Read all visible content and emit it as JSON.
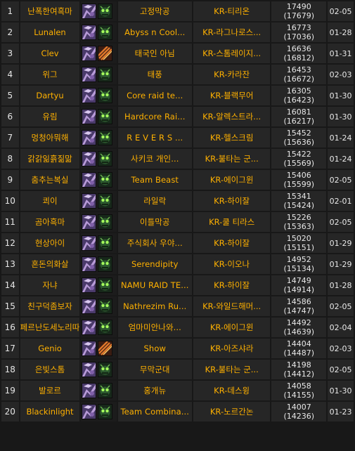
{
  "rows": [
    {
      "rank": "1",
      "name": "난폭한여흑마",
      "class_icon": "warlock-class-icon",
      "spec_icon": "warlock-spec-icon",
      "guild": "고정막공",
      "realm": "KR-티리온",
      "score": "17490",
      "score_alt": "(17679)",
      "date": "02-05"
    },
    {
      "rank": "2",
      "name": "Lunalen",
      "class_icon": "warlock-class-icon",
      "spec_icon": "warlock-spec-icon",
      "guild": "Abyss n Cool...",
      "realm": "KR-라그나로스...",
      "score": "16773",
      "score_alt": "(17036)",
      "date": "01-28"
    },
    {
      "rank": "3",
      "name": "Clev",
      "class_icon": "warlock-class-icon",
      "spec_icon": "destruction-spec-icon",
      "guild": "태국인 아님",
      "realm": "KR-스톰레이지...",
      "score": "16636",
      "score_alt": "(16812)",
      "date": "01-31"
    },
    {
      "rank": "4",
      "name": "위그",
      "class_icon": "warlock-class-icon",
      "spec_icon": "warlock-spec-icon",
      "guild": "태풍",
      "realm": "KR-카라잔",
      "score": "16453",
      "score_alt": "(16672)",
      "date": "02-03"
    },
    {
      "rank": "5",
      "name": "Dartyu",
      "class_icon": "warlock-class-icon",
      "spec_icon": "warlock-spec-icon",
      "guild": "Core raid te...",
      "realm": "KR-블랙무어",
      "score": "16305",
      "score_alt": "(16423)",
      "date": "01-30"
    },
    {
      "rank": "6",
      "name": "유림",
      "class_icon": "warlock-class-icon",
      "spec_icon": "warlock-spec-icon",
      "guild": "Hardcore Rai...",
      "realm": "KR-알렉스트라...",
      "score": "16081",
      "score_alt": "(16217)",
      "date": "01-30"
    },
    {
      "rank": "7",
      "name": "멍청아뭐해",
      "class_icon": "warlock-class-icon",
      "spec_icon": "warlock-spec-icon",
      "guild": "R E V E R S ...",
      "realm": "KR-헬스크림",
      "score": "15452",
      "score_alt": "(15636)",
      "date": "01-24"
    },
    {
      "rank": "8",
      "name": "갉갉읾흙짊맒",
      "class_icon": "warlock-class-icon",
      "spec_icon": "warlock-spec-icon",
      "guild": "사키코 개인...",
      "realm": "KR-불타는 군...",
      "score": "15422",
      "score_alt": "(15569)",
      "date": "01-24"
    },
    {
      "rank": "9",
      "name": "춤추는복실",
      "class_icon": "warlock-class-icon",
      "spec_icon": "warlock-spec-icon",
      "guild": "Team Beast",
      "realm": "KR-에이그윈",
      "score": "15406",
      "score_alt": "(15599)",
      "date": "02-05"
    },
    {
      "rank": "10",
      "name": "쾨이",
      "class_icon": "warlock-class-icon",
      "spec_icon": "warlock-spec-icon",
      "guild": "라일락",
      "realm": "KR-하이잘",
      "score": "15341",
      "score_alt": "(15424)",
      "date": "02-01"
    },
    {
      "rank": "11",
      "name": "곰아흑마",
      "class_icon": "warlock-class-icon",
      "spec_icon": "warlock-spec-icon",
      "guild": "이틀막공",
      "realm": "KR-쿨 티라스",
      "score": "15226",
      "score_alt": "(15363)",
      "date": "02-05"
    },
    {
      "rank": "12",
      "name": "현상아이",
      "class_icon": "warlock-class-icon",
      "spec_icon": "warlock-spec-icon",
      "guild": "주식회사 우야...",
      "realm": "KR-하이잘",
      "score": "15020",
      "score_alt": "(15151)",
      "date": "01-29"
    },
    {
      "rank": "13",
      "name": "혼돈의화살",
      "class_icon": "warlock-class-icon",
      "spec_icon": "warlock-spec-icon",
      "guild": "Serendipity",
      "realm": "KR-이오나",
      "score": "14952",
      "score_alt": "(15134)",
      "date": "01-29"
    },
    {
      "rank": "14",
      "name": "자냐",
      "class_icon": "warlock-class-icon",
      "spec_icon": "warlock-spec-icon",
      "guild": "NAMU RAID TE...",
      "realm": "KR-하이잘",
      "score": "14749",
      "score_alt": "(14914)",
      "date": "01-28"
    },
    {
      "rank": "15",
      "name": "친구덕좀보자",
      "class_icon": "warlock-class-icon",
      "spec_icon": "warlock-spec-icon",
      "guild": "Nathrezim Ru...",
      "realm": "KR-와일드해머...",
      "score": "14586",
      "score_alt": "(14747)",
      "date": "02-05"
    },
    {
      "rank": "16",
      "name": "페르난도세노리따",
      "class_icon": "warlock-class-icon",
      "spec_icon": "warlock-spec-icon",
      "guild": "엄마미안나와...",
      "realm": "KR-에이그윈",
      "score": "14492",
      "score_alt": "(14639)",
      "date": "02-04"
    },
    {
      "rank": "17",
      "name": "Genio",
      "class_icon": "warlock-class-icon",
      "spec_icon": "destruction-spec-icon",
      "guild": "Show",
      "realm": "KR-아즈샤라",
      "score": "14404",
      "score_alt": "(14487)",
      "date": "02-03"
    },
    {
      "rank": "18",
      "name": "은빛스톰",
      "class_icon": "warlock-class-icon",
      "spec_icon": "warlock-spec-icon",
      "guild": "무막군대",
      "realm": "KR-불타는 군...",
      "score": "14198",
      "score_alt": "(14412)",
      "date": "02-05"
    },
    {
      "rank": "19",
      "name": "발로르",
      "class_icon": "warlock-class-icon",
      "spec_icon": "warlock-spec-icon",
      "guild": "홍개뉴",
      "realm": "KR-데스윙",
      "score": "14058",
      "score_alt": "(14155)",
      "date": "01-30"
    },
    {
      "rank": "20",
      "name": "Blackinlight",
      "class_icon": "warlock-class-icon",
      "spec_icon": "warlock-spec-icon",
      "guild": "Team Combina...",
      "realm": "KR-노르간논",
      "score": "14007",
      "score_alt": "(14236)",
      "date": "01-23"
    }
  ],
  "colors": {
    "background": "#181818",
    "cell": "#262626",
    "accent_text": "#ffb100",
    "plain_text": "#e8e8e8"
  }
}
